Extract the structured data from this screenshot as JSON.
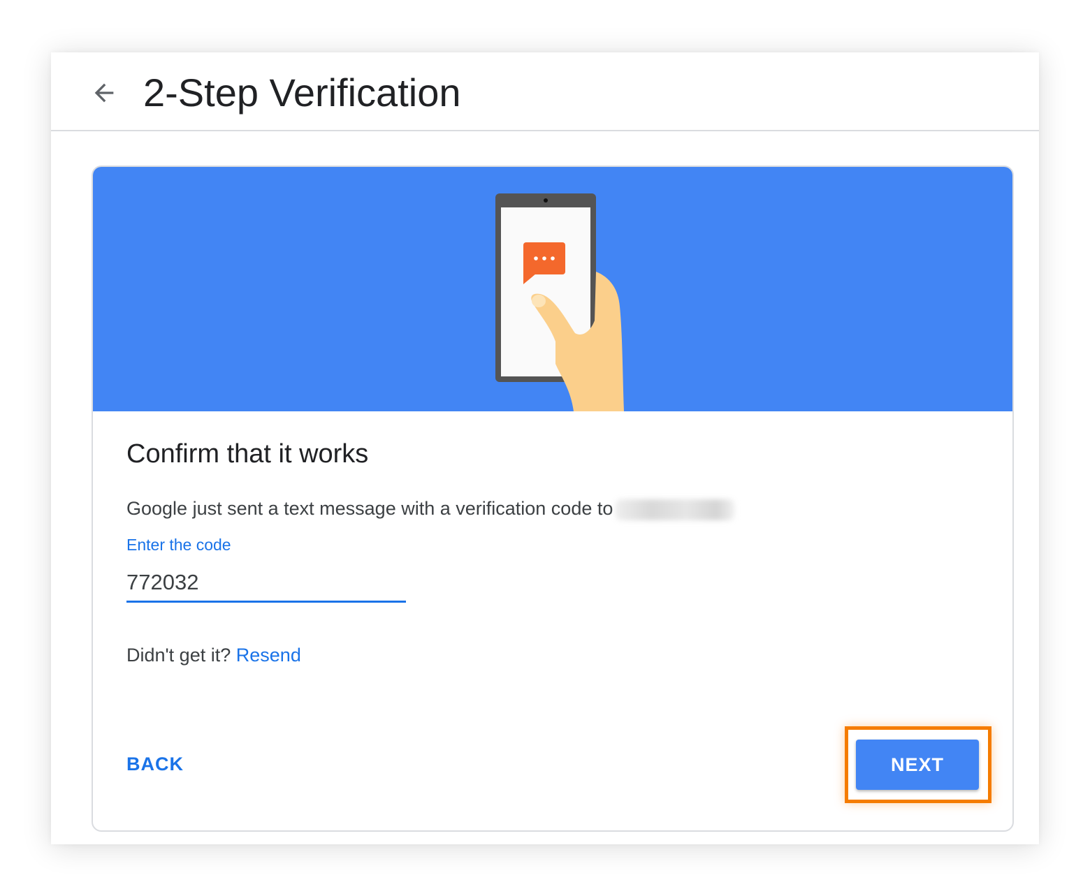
{
  "header": {
    "title": "2-Step Verification",
    "back_icon": "arrow-left-icon"
  },
  "hero": {
    "illustration": "phone-message-illustration",
    "message_icon": "chat-bubble-icon",
    "colors": {
      "background": "#4285f4",
      "bubble": "#f4682c",
      "hand": "#fbcf8b"
    }
  },
  "confirm": {
    "heading": "Confirm that it works",
    "description": "Google just sent a text message with a verification code to",
    "code_label": "Enter the code",
    "code_value": "772032",
    "resend_prompt": "Didn't get it?",
    "resend_link": "Resend"
  },
  "actions": {
    "back_label": "BACK",
    "next_label": "NEXT",
    "highlight_color": "#f57c00"
  },
  "colors": {
    "accent": "#1a73e8",
    "button": "#4285f4",
    "text": "#202124"
  }
}
